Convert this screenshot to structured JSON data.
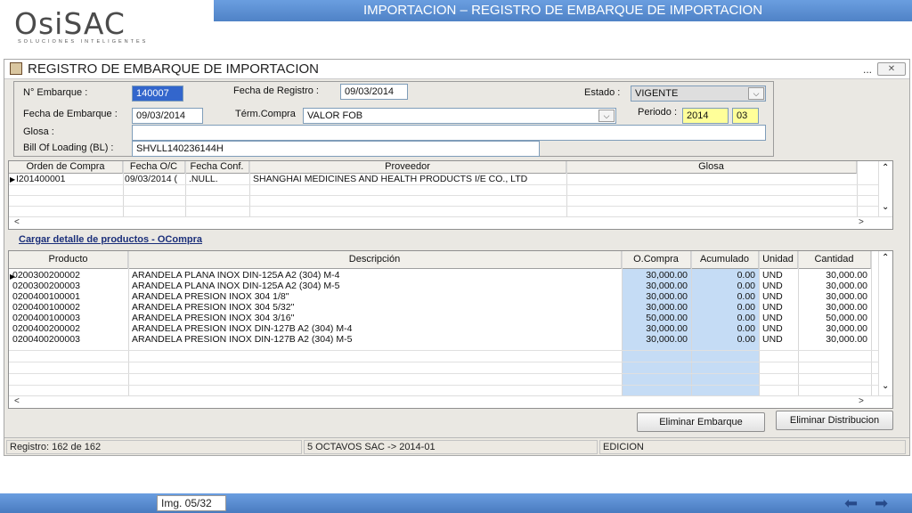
{
  "slide": {
    "logo_text": "OsiSAC",
    "logo_sub": "SOLUCIONES INTELIGENTES",
    "title": "IMPORTACION – REGISTRO DE EMBARQUE DE IMPORTACION",
    "img_label": "Img. 05/32"
  },
  "window": {
    "title": "REGISTRO DE EMBARQUE DE IMPORTACION",
    "dots": "...",
    "close": "✕"
  },
  "form": {
    "embarque_label": "N° Embarque :",
    "embarque_value": "140007",
    "fecha_registro_label": "Fecha de Registro :",
    "fecha_registro_value": "09/03/2014",
    "estado_label": "Estado :",
    "estado_value": "VIGENTE",
    "fecha_embarque_label": "Fecha de Embarque :",
    "fecha_embarque_value": "09/03/2014",
    "term_compra_label": "Térm.Compra",
    "term_compra_value": "VALOR FOB",
    "periodo_label": "Periodo :",
    "periodo_year": "2014",
    "periodo_month": "03",
    "glosa_label": "Glosa :",
    "glosa_value": "",
    "bl_label": "Bill Of Loading (BL) :",
    "bl_value": "SHVLL140236144H"
  },
  "orders_grid": {
    "columns": [
      "Orden de Compra",
      "Fecha O/C",
      "Fecha Conf.",
      "Proveedor",
      "Glosa"
    ],
    "rows": [
      [
        "I201400001",
        "09/03/2014 (",
        ".NULL.",
        "SHANGHAI MEDICINES AND HEALTH PRODUCTS I/E CO., LTD",
        ""
      ]
    ]
  },
  "load_link": "Cargar detalle de productos - OCompra",
  "products_grid": {
    "columns": [
      "Producto",
      "Descripción",
      "O.Compra",
      "Acumulado",
      "Unidad",
      "Cantidad"
    ],
    "rows": [
      [
        "0200300200002",
        "ARANDELA PLANA INOX DIN-125A A2 (304) M-4",
        "30,000.00",
        "0.00",
        "UND",
        "30,000.00"
      ],
      [
        "0200300200003",
        "ARANDELA PLANA INOX DIN-125A A2 (304) M-5",
        "30,000.00",
        "0.00",
        "UND",
        "30,000.00"
      ],
      [
        "0200400100001",
        "ARANDELA PRESION INOX 304 1/8\"",
        "30,000.00",
        "0.00",
        "UND",
        "30,000.00"
      ],
      [
        "0200400100002",
        "ARANDELA PRESION INOX 304 5/32\"",
        "30,000.00",
        "0.00",
        "UND",
        "30,000.00"
      ],
      [
        "0200400100003",
        "ARANDELA PRESION INOX 304 3/16\"",
        "50,000.00",
        "0.00",
        "UND",
        "50,000.00"
      ],
      [
        "0200400200002",
        "ARANDELA PRESION INOX DIN-127B A2 (304) M-4",
        "30,000.00",
        "0.00",
        "UND",
        "30,000.00"
      ],
      [
        "0200400200003",
        "ARANDELA PRESION INOX DIN-127B A2 (304) M-5",
        "30,000.00",
        "0.00",
        "UND",
        "30,000.00"
      ]
    ]
  },
  "buttons": {
    "eliminar_embarque": "Eliminar Embarque",
    "eliminar_distribucion": "Eliminar Distribucion"
  },
  "status": {
    "registro": "Registro: 162 de 162",
    "empresa": "5 OCTAVOS SAC -> 2014-01",
    "modo": "EDICION"
  },
  "colors": {
    "title_bar": "#5b8fd1",
    "selection": "#3366cc",
    "highlight_column": "#c5dcf5",
    "periodo_field": "#ffff99"
  }
}
